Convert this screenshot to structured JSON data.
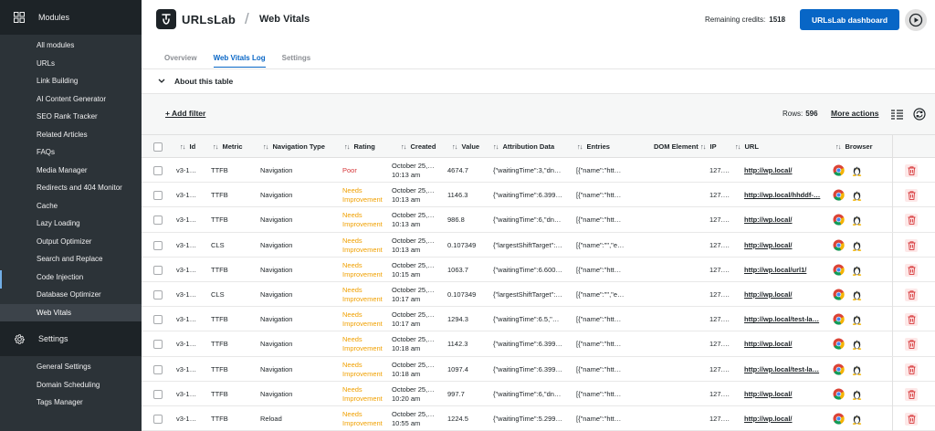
{
  "sidebar": {
    "modules_label": "Modules",
    "items": [
      {
        "label": "All modules"
      },
      {
        "label": "URLs"
      },
      {
        "label": "Link Building"
      },
      {
        "label": "AI Content Generator"
      },
      {
        "label": "SEO Rank Tracker"
      },
      {
        "label": "Related Articles"
      },
      {
        "label": "FAQs"
      },
      {
        "label": "Media Manager"
      },
      {
        "label": "Redirects and 404 Monitor"
      },
      {
        "label": "Cache"
      },
      {
        "label": "Lazy Loading"
      },
      {
        "label": "Output Optimizer"
      },
      {
        "label": "Search and Replace"
      },
      {
        "label": "Code Injection"
      },
      {
        "label": "Database Optimizer"
      },
      {
        "label": "Web Vitals",
        "active": true
      }
    ],
    "settings_label": "Settings",
    "settings_items": [
      {
        "label": "General Settings"
      },
      {
        "label": "Domain Scheduling"
      },
      {
        "label": "Tags Manager"
      }
    ]
  },
  "header": {
    "brand": "URLsLab",
    "separator": "/",
    "title": "Web Vitals",
    "credits_label": "Remaining credits:",
    "credits_value": "1518",
    "dashboard_button": "URLsLab dashboard"
  },
  "tabs": [
    {
      "label": "Overview"
    },
    {
      "label": "Web Vitals Log",
      "active": true
    },
    {
      "label": "Settings"
    }
  ],
  "about": {
    "label": "About this table"
  },
  "toolbar": {
    "add_filter": "+ Add filter",
    "rows_label": "Rows:",
    "rows_value": "596",
    "more_actions": "More actions"
  },
  "table": {
    "columns": [
      "Id",
      "Metric",
      "Navigation Type",
      "Rating",
      "Created",
      "Value",
      "Attribution Data",
      "Entries",
      "DOM Element",
      "IP",
      "URL",
      "Browser"
    ],
    "rows": [
      {
        "id": "v3-1…",
        "metric": "TTFB",
        "nav": "Navigation",
        "rating": "Poor",
        "rating_class": "poor",
        "created_date": "October 25,…",
        "created_time": "10:13 am",
        "value": "4674.7",
        "attribution": "{\"waitingTime\":3,\"dn…",
        "entries": "[{\"name\":\"htt…",
        "ip": "127.…",
        "url": "http://wp.local/"
      },
      {
        "id": "v3-1…",
        "metric": "TTFB",
        "nav": "Navigation",
        "rating": "Needs Improvement",
        "rating_class": "needs",
        "created_date": "October 25,…",
        "created_time": "10:13 am",
        "value": "1146.3",
        "attribution": "{\"waitingTime\":6.399…",
        "entries": "[{\"name\":\"htt…",
        "ip": "127.…",
        "url": "http://wp.local/hhddf-…"
      },
      {
        "id": "v3-1…",
        "metric": "TTFB",
        "nav": "Navigation",
        "rating": "Needs Improvement",
        "rating_class": "needs",
        "created_date": "October 25,…",
        "created_time": "10:13 am",
        "value": "986.8",
        "attribution": "{\"waitingTime\":6,\"dn…",
        "entries": "[{\"name\":\"htt…",
        "ip": "127.…",
        "url": "http://wp.local/"
      },
      {
        "id": "v3-1…",
        "metric": "CLS",
        "nav": "Navigation",
        "rating": "Needs Improvement",
        "rating_class": "needs",
        "created_date": "October 25,…",
        "created_time": "10:13 am",
        "value": "0.107349",
        "attribution": "{\"largestShiftTarget\":…",
        "entries": "[{\"name\":\"\",\"e…",
        "ip": "127.…",
        "url": "http://wp.local/"
      },
      {
        "id": "v3-1…",
        "metric": "TTFB",
        "nav": "Navigation",
        "rating": "Needs Improvement",
        "rating_class": "needs",
        "created_date": "October 25,…",
        "created_time": "10:15 am",
        "value": "1063.7",
        "attribution": "{\"waitingTime\":6.600…",
        "entries": "[{\"name\":\"htt…",
        "ip": "127.…",
        "url": "http://wp.local/url1/"
      },
      {
        "id": "v3-1…",
        "metric": "CLS",
        "nav": "Navigation",
        "rating": "Needs Improvement",
        "rating_class": "needs",
        "created_date": "October 25,…",
        "created_time": "10:17 am",
        "value": "0.107349",
        "attribution": "{\"largestShiftTarget\":…",
        "entries": "[{\"name\":\"\",\"e…",
        "ip": "127.…",
        "url": "http://wp.local/"
      },
      {
        "id": "v3-1…",
        "metric": "TTFB",
        "nav": "Navigation",
        "rating": "Needs Improvement",
        "rating_class": "needs",
        "created_date": "October 25,…",
        "created_time": "10:17 am",
        "value": "1294.3",
        "attribution": "{\"waitingTime\":6.5,\"…",
        "entries": "[{\"name\":\"htt…",
        "ip": "127.…",
        "url": "http://wp.local/test-la…"
      },
      {
        "id": "v3-1…",
        "metric": "TTFB",
        "nav": "Navigation",
        "rating": "Needs Improvement",
        "rating_class": "needs",
        "created_date": "October 25,…",
        "created_time": "10:18 am",
        "value": "1142.3",
        "attribution": "{\"waitingTime\":6.399…",
        "entries": "[{\"name\":\"htt…",
        "ip": "127.…",
        "url": "http://wp.local/"
      },
      {
        "id": "v3-1…",
        "metric": "TTFB",
        "nav": "Navigation",
        "rating": "Needs Improvement",
        "rating_class": "needs",
        "created_date": "October 25,…",
        "created_time": "10:18 am",
        "value": "1097.4",
        "attribution": "{\"waitingTime\":6.399…",
        "entries": "[{\"name\":\"htt…",
        "ip": "127.…",
        "url": "http://wp.local/test-la…"
      },
      {
        "id": "v3-1…",
        "metric": "TTFB",
        "nav": "Navigation",
        "rating": "Needs Improvement",
        "rating_class": "needs",
        "created_date": "October 25,…",
        "created_time": "10:20 am",
        "value": "997.7",
        "attribution": "{\"waitingTime\":6,\"dn…",
        "entries": "[{\"name\":\"htt…",
        "ip": "127.…",
        "url": "http://wp.local/"
      },
      {
        "id": "v3-1…",
        "metric": "TTFB",
        "nav": "Reload",
        "rating": "Needs Improvement",
        "rating_class": "needs",
        "created_date": "October 25,…",
        "created_time": "10:55 am",
        "value": "1224.5",
        "attribution": "{\"waitingTime\":5.299…",
        "entries": "[{\"name\":\"htt…",
        "ip": "127.…",
        "url": "http://wp.local/"
      }
    ]
  },
  "colors": {
    "accent": "#0866c6",
    "poor": "#d63638",
    "needs": "#f0a000",
    "sidebar": "#2c3338"
  }
}
